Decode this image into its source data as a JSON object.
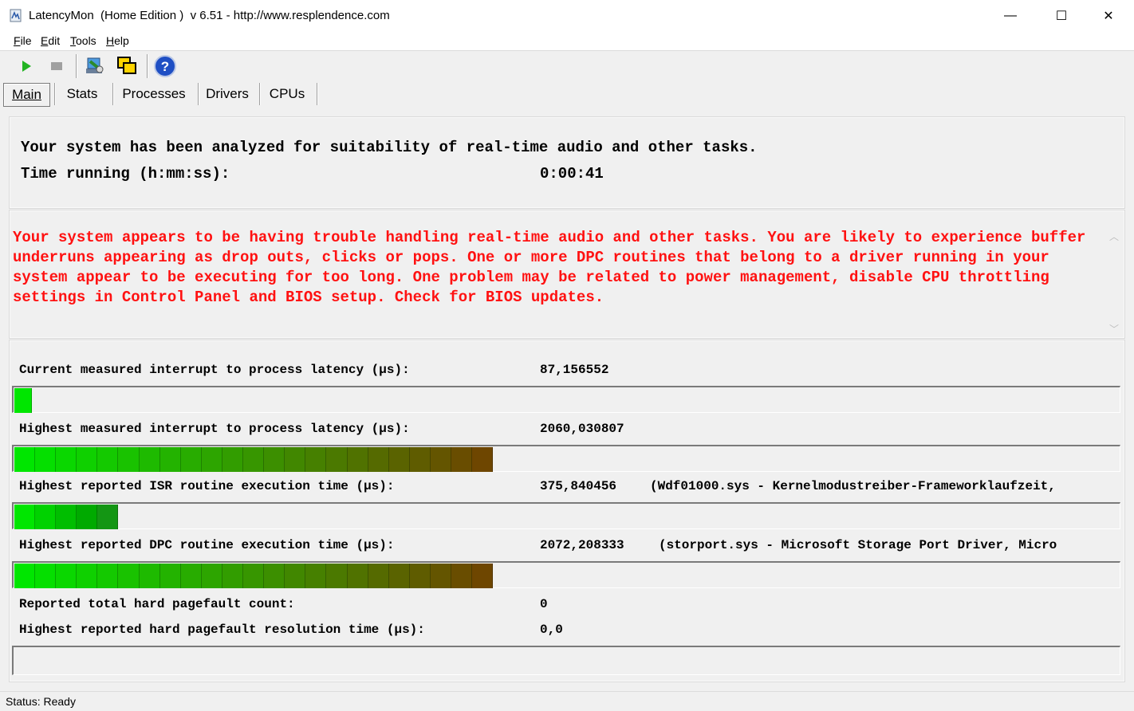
{
  "window": {
    "title": "LatencyMon  (Home Edition )  v 6.51 - http://www.resplendence.com",
    "minimize_glyph": "—",
    "maximize_glyph": "☐",
    "close_glyph": "✕"
  },
  "menu": [
    {
      "accel": "F",
      "rest": "ile"
    },
    {
      "accel": "E",
      "rest": "dit"
    },
    {
      "accel": "T",
      "rest": "ools"
    },
    {
      "accel": "H",
      "rest": "elp"
    }
  ],
  "toolbar": {
    "icons": [
      "play-icon",
      "stop-icon",
      "analyze-icon",
      "windows-icon",
      "help-icon"
    ],
    "colors": {
      "play": "#22b422",
      "stop": "#a0a0a0",
      "help": "#1f4fc4"
    }
  },
  "tabs": [
    {
      "label": "Main"
    },
    {
      "label": "Stats"
    },
    {
      "label": "Processes"
    },
    {
      "label": "Drivers"
    },
    {
      "label": "CPUs"
    }
  ],
  "summary": {
    "line1": "Your system has been analyzed for suitability of real-time audio and other tasks.",
    "time_label": "Time running (h:mm:ss):",
    "time_value": "0:00:41"
  },
  "warning": {
    "text": "Your system appears to be having trouble handling real-time audio and other tasks. You are likely to experience buffer underruns appearing as drop outs, clicks or pops. One or more DPC routines that belong to a driver running in your system appear to be executing for too long. One problem may be related to power management, disable CPU throttling settings in Control Panel and BIOS setup. Check for BIOS updates.",
    "color": "#ff1111"
  },
  "metrics": {
    "current_latency": {
      "label": "Current measured interrupt to process latency (µs):",
      "value": "87,156552",
      "fill_segments": 1
    },
    "highest_latency": {
      "label": "Highest measured interrupt to process latency (µs):",
      "value": "2060,030807",
      "fill_segments": 23
    },
    "isr": {
      "label": "Highest reported ISR routine execution time (µs):",
      "value": "375,840456",
      "extra": "(Wdf01000.sys - Kernelmodustreiber-Frameworklaufzeit,",
      "fill_segments": 5
    },
    "dpc": {
      "label": "Highest reported DPC routine execution time (µs):",
      "value": "2072,208333",
      "extra": "(storport.sys - Microsoft Storage Port Driver, Micro",
      "fill_segments": 23
    },
    "pagefault_count": {
      "label": "Reported total hard pagefault count:",
      "value": "0"
    },
    "pagefault_time": {
      "label": "Highest reported hard pagefault resolution time (µs):",
      "value": "0,0",
      "fill_segments": 0
    }
  },
  "status": {
    "text": "Status: Ready"
  }
}
